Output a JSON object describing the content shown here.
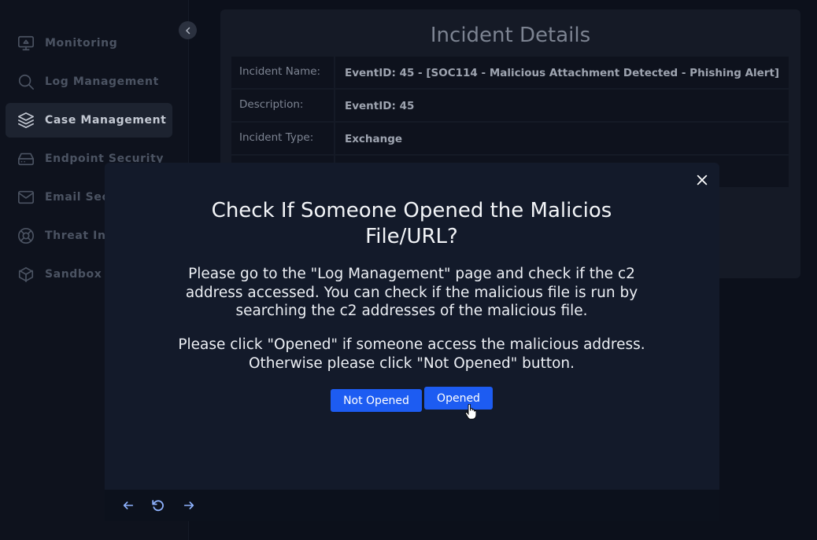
{
  "sidebar": {
    "items": [
      {
        "label": "Monitoring",
        "icon": "monitor-icon",
        "active": false
      },
      {
        "label": "Log Management",
        "icon": "search-icon",
        "active": false
      },
      {
        "label": "Case Management",
        "icon": "layers-icon",
        "active": true
      },
      {
        "label": "Endpoint Security",
        "icon": "hard-drive-icon",
        "active": false
      },
      {
        "label": "Email Sec",
        "icon": "mail-icon",
        "active": false
      },
      {
        "label": "Threat Int",
        "icon": "lifebuoy-icon",
        "active": false
      },
      {
        "label": "Sandbox",
        "icon": "box-icon",
        "active": false
      }
    ]
  },
  "panel": {
    "title": "Incident Details",
    "rows": [
      {
        "key": "Incident Name:",
        "value": "EventID: 45 - [SOC114 - Malicious Attachment Detected - Phishing Alert]"
      },
      {
        "key": "Description:",
        "value": "EventID: 45"
      },
      {
        "key": "Incident Type:",
        "value": "Exchange"
      },
      {
        "key": "",
        "value": ""
      }
    ]
  },
  "modal": {
    "title": "Check If Someone Opened the Malicios File/URL?",
    "text1": "Please go to the \"Log Management\" page and check if the c2 address accessed. You can check if the malicious file is run by searching the c2 addresses of the malicious file.",
    "text2": "Please click \"Opened\" if someone access the malicious address. Otherwise please click \"Not Opened\" button.",
    "not_opened_label": "Not Opened",
    "opened_label": "Opened"
  },
  "colors": {
    "accent": "#1d5cf2",
    "background": "#0c101b",
    "modal_bg": "#131a2a"
  }
}
